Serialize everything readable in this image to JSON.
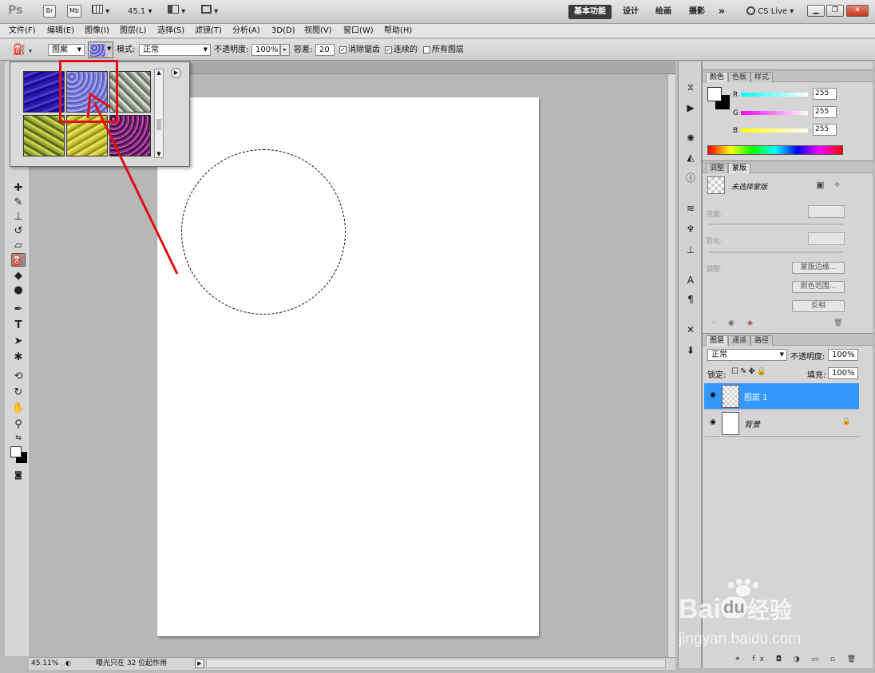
{
  "app": {
    "logo": "Ps"
  },
  "titlebar": {
    "bridge": "Br",
    "minibridge": "Mb",
    "zoom": "45.1",
    "workspaces": [
      "基本功能",
      "设计",
      "绘画",
      "摄影"
    ],
    "more": "»",
    "cslive": "CS Live"
  },
  "menu": [
    "文件(F)",
    "编辑(E)",
    "图像(I)",
    "图层(L)",
    "选择(S)",
    "滤镜(T)",
    "分析(A)",
    "3D(D)",
    "视图(V)",
    "窗口(W)",
    "帮助(H)"
  ],
  "options": {
    "fill_source": "图案",
    "mode_label": "模式:",
    "mode_value": "正常",
    "opacity_label": "不透明度:",
    "opacity_value": "100%",
    "tolerance_label": "容差:",
    "tolerance_value": "20",
    "antialias_label": "消除锯齿",
    "contiguous_label": "连续的",
    "all_layers_label": "所有图层"
  },
  "pattern_picker": {
    "swatches": [
      {
        "name": "blue-ripple",
        "color": "#2a1aa8"
      },
      {
        "name": "blue-flowers",
        "color": "#7a7ad8",
        "selected": true
      },
      {
        "name": "gray-leaves",
        "color": "#8a8f86"
      },
      {
        "name": "green-leaves",
        "color": "#9aa83a"
      },
      {
        "name": "yellow-leaves",
        "color": "#c8c23c"
      },
      {
        "name": "purple-flowers",
        "color": "#6e2a6e"
      }
    ]
  },
  "color_panel": {
    "tabs": [
      "颜色",
      "色板",
      "样式"
    ],
    "r_label": "R",
    "g_label": "G",
    "b_label": "B",
    "r": "255",
    "g": "255",
    "b": "255"
  },
  "masks_panel": {
    "tabs": [
      "调整",
      "蒙版"
    ],
    "no_selection": "未选择蒙版",
    "density_label": "浓度:",
    "feather_label": "羽化:",
    "adjust_label": "调整:",
    "btn_edge": "蒙版边缘...",
    "btn_color_range": "颜色范围...",
    "btn_invert": "反相"
  },
  "layers_panel": {
    "tabs": [
      "图层",
      "通道",
      "路径"
    ],
    "blend": "正常",
    "opacity_label": "不透明度:",
    "opacity": "100%",
    "lock_label": "锁定:",
    "fill_label": "填充:",
    "fill": "100%",
    "layers": [
      {
        "name": "图层 1",
        "selected": true
      },
      {
        "name": "背景",
        "selected": false
      }
    ]
  },
  "status": {
    "zoom": "45.11%",
    "message": "曝光只在 32 位起作用"
  },
  "watermark": {
    "brand_left": "Bai",
    "brand_mid": "du",
    "brand_cn": "经验",
    "url": "jingyan.baidu.com"
  },
  "colors": {
    "selection_highlight": "#3399ff",
    "annotation": "#e01010"
  }
}
